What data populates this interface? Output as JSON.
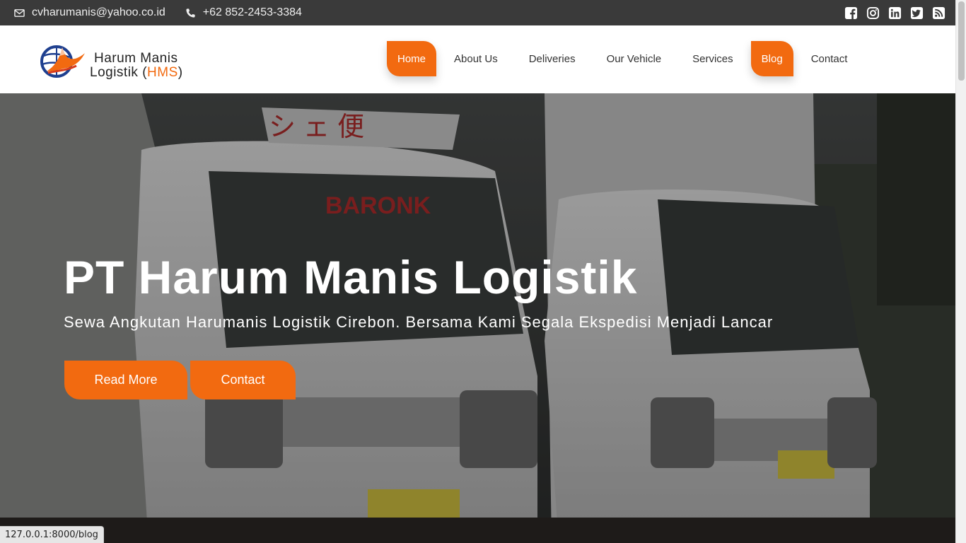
{
  "topbar": {
    "email": "cvharumanis@yahoo.co.id",
    "phone": "+62 852-2453-3384",
    "social": [
      "facebook-icon",
      "instagram-icon",
      "linkedin-icon",
      "twitter-icon",
      "rss-icon"
    ]
  },
  "logo": {
    "line1": "Harum Manis",
    "line2_prefix": "Logistik (",
    "line2_accent": "HMS",
    "line2_suffix": ")"
  },
  "nav": {
    "items": [
      {
        "label": "Home",
        "active": true
      },
      {
        "label": "About Us",
        "active": false
      },
      {
        "label": "Deliveries",
        "active": false
      },
      {
        "label": "Our Vehicle",
        "active": false
      },
      {
        "label": "Services",
        "active": false
      },
      {
        "label": "Blog",
        "active": true
      },
      {
        "label": "Contact",
        "active": false
      }
    ]
  },
  "hero": {
    "title": "PT Harum Manis Logistik",
    "subtitle": "Sewa Angkutan Harumanis Logistik Cirebon. Bersama Kami Segala Ekspedisi Menjadi Lancar",
    "read_more": "Read More",
    "contact": "Contact"
  },
  "status": {
    "url": "127.0.0.1:8000/blog"
  },
  "colors": {
    "accent": "#f26a10",
    "topbar": "#3a3a3a"
  }
}
